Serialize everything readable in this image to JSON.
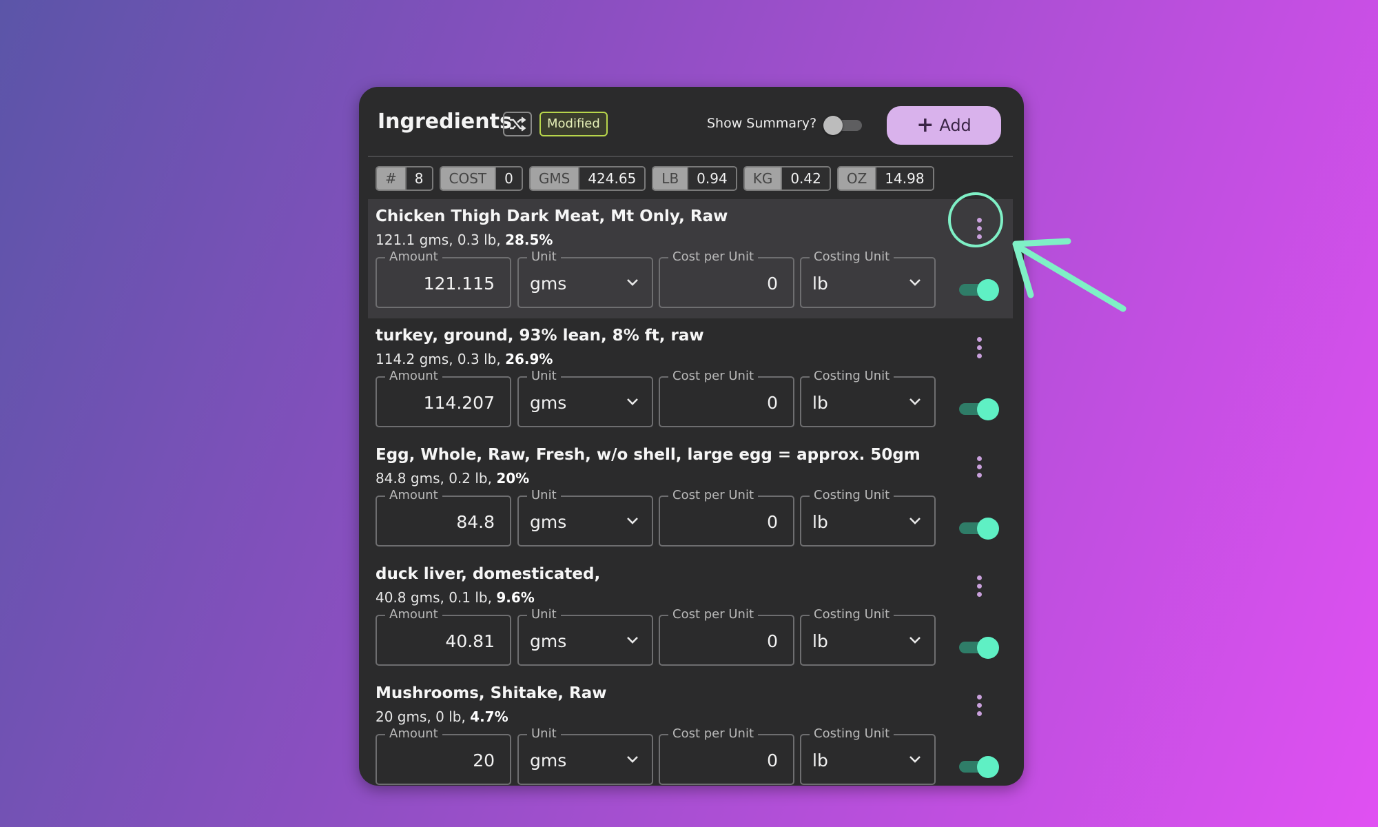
{
  "header": {
    "title": "Ingredients",
    "modified_badge": "Modified",
    "show_summary_label": "Show Summary?",
    "show_summary_on": false,
    "add_label": "Add"
  },
  "stats": [
    {
      "key": "#",
      "value": "8"
    },
    {
      "key": "COST",
      "value": "0"
    },
    {
      "key": "GMS",
      "value": "424.65"
    },
    {
      "key": "LB",
      "value": "0.94"
    },
    {
      "key": "KG",
      "value": "0.42"
    },
    {
      "key": "OZ",
      "value": "14.98"
    }
  ],
  "field_labels": {
    "amount": "Amount",
    "unit": "Unit",
    "cost": "Cost per Unit",
    "costing_unit": "Costing Unit"
  },
  "ingredients": [
    {
      "name": "Chicken Thigh Dark Meat, Mt Only, Raw",
      "summary": "121.1 gms, 0.3 lb,",
      "percent": "28.5%",
      "amount": "121.115",
      "unit": "gms",
      "cost": "0",
      "costing_unit": "lb",
      "enabled": true
    },
    {
      "name": "turkey, ground, 93% lean, 8% ft, raw",
      "summary": "114.2 gms, 0.3 lb,",
      "percent": "26.9%",
      "amount": "114.207",
      "unit": "gms",
      "cost": "0",
      "costing_unit": "lb",
      "enabled": true
    },
    {
      "name": "Egg, Whole, Raw, Fresh, w/o shell, large egg = approx. 50gm",
      "summary": "84.8 gms, 0.2 lb,",
      "percent": "20%",
      "amount": "84.8",
      "unit": "gms",
      "cost": "0",
      "costing_unit": "lb",
      "enabled": true
    },
    {
      "name": "duck liver, domesticated,",
      "summary": "40.8 gms, 0.1 lb,",
      "percent": "9.6%",
      "amount": "40.81",
      "unit": "gms",
      "cost": "0",
      "costing_unit": "lb",
      "enabled": true
    },
    {
      "name": "Mushrooms, Shitake, Raw",
      "summary": "20 gms, 0 lb,",
      "percent": "4.7%",
      "amount": "20",
      "unit": "gms",
      "cost": "0",
      "costing_unit": "lb",
      "enabled": true
    }
  ],
  "colors": {
    "accent_green": "#5ff0c4",
    "add_button": "#d9b2ec",
    "badge_border": "#b8d64b",
    "kebab": "#c9a0dc"
  }
}
